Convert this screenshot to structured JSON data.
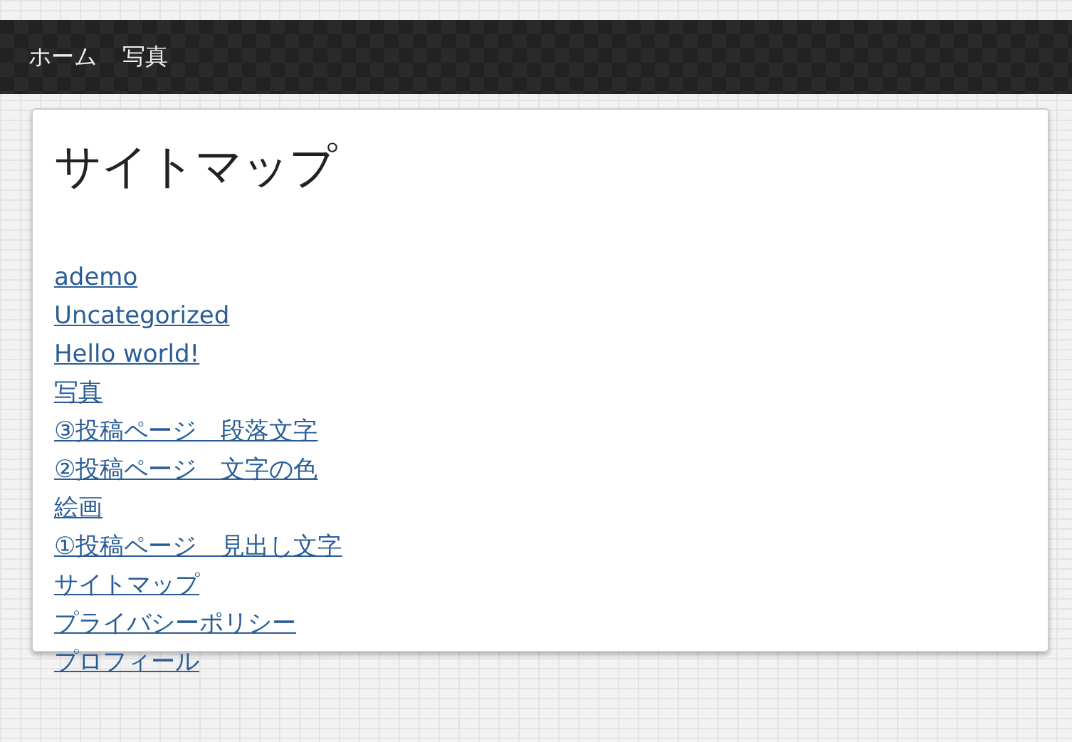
{
  "nav": {
    "items": [
      {
        "label": "ホーム"
      },
      {
        "label": "写真"
      }
    ]
  },
  "page": {
    "title": "サイトマップ",
    "links": [
      {
        "label": "ademo"
      },
      {
        "label": "Uncategorized"
      },
      {
        "label": "Hello world!"
      },
      {
        "label": "写真"
      },
      {
        "label": "③投稿ページ　段落文字"
      },
      {
        "label": "②投稿ページ　文字の色"
      },
      {
        "label": "絵画"
      },
      {
        "label": "①投稿ページ　見出し文字"
      },
      {
        "label": "サイトマップ"
      },
      {
        "label": "プライバシーポリシー"
      },
      {
        "label": "プロフィール"
      }
    ]
  }
}
